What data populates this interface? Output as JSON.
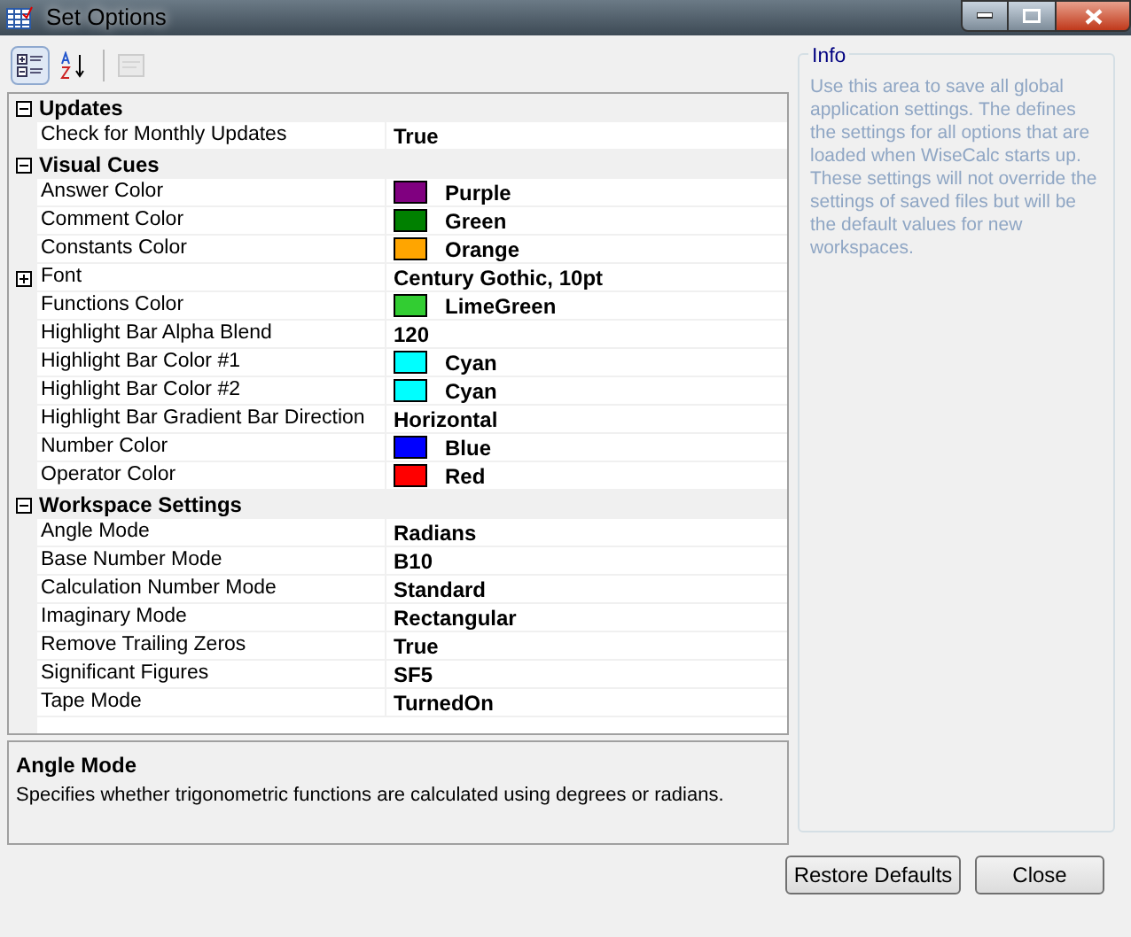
{
  "window": {
    "title": "Set Options"
  },
  "toolbar": [
    {
      "kind": "categorized",
      "selected": true,
      "disabled": false
    },
    {
      "kind": "alphabetical",
      "selected": false,
      "disabled": false
    },
    {
      "kind": "pages",
      "selected": false,
      "disabled": true
    }
  ],
  "groups": [
    {
      "name": "Updates",
      "expanded": true,
      "items": [
        {
          "name": "Check for Monthly Updates",
          "value": "True"
        }
      ]
    },
    {
      "name": "Visual Cues",
      "expanded": true,
      "items": [
        {
          "name": "Answer Color",
          "value": "Purple",
          "color": "#800080"
        },
        {
          "name": "Comment Color",
          "value": "Green",
          "color": "#008000"
        },
        {
          "name": "Constants Color",
          "value": "Orange",
          "color": "#ffa500"
        },
        {
          "name": "Font",
          "value": "Century Gothic, 10pt",
          "expanded": false
        },
        {
          "name": "Functions Color",
          "value": "LimeGreen",
          "color": "#32cd32"
        },
        {
          "name": "Highlight Bar Alpha Blend",
          "value": "120"
        },
        {
          "name": "Highlight Bar Color #1",
          "value": "Cyan",
          "color": "#00ffff"
        },
        {
          "name": "Highlight Bar Color #2",
          "value": "Cyan",
          "color": "#00ffff"
        },
        {
          "name": "Highlight Bar Gradient Bar Direction",
          "value": "Horizontal"
        },
        {
          "name": "Number Color",
          "value": "Blue",
          "color": "#0000ff"
        },
        {
          "name": "Operator Color",
          "value": "Red",
          "color": "#ff0000"
        }
      ]
    },
    {
      "name": "Workspace Settings",
      "expanded": true,
      "items": [
        {
          "name": "Angle Mode",
          "value": "Radians"
        },
        {
          "name": "Base Number Mode",
          "value": "B10"
        },
        {
          "name": "Calculation Number Mode",
          "value": "Standard"
        },
        {
          "name": "Imaginary Mode",
          "value": "Rectangular"
        },
        {
          "name": "Remove Trailing Zeros",
          "value": "True"
        },
        {
          "name": "Significant Figures",
          "value": "SF5"
        },
        {
          "name": "Tape Mode",
          "value": "TurnedOn"
        }
      ]
    }
  ],
  "description": {
    "title": "Angle Mode",
    "text": "Specifies whether trigonometric functions are calculated using degrees or radians."
  },
  "info": {
    "title": "Info",
    "text": "Use this area to save all global application settings.  The defines the settings for all options that are loaded when WiseCalc starts up.  These settings will not override the settings of saved files but will be the default values for new workspaces."
  },
  "buttons": [
    "Restore Defaults",
    "Close"
  ]
}
